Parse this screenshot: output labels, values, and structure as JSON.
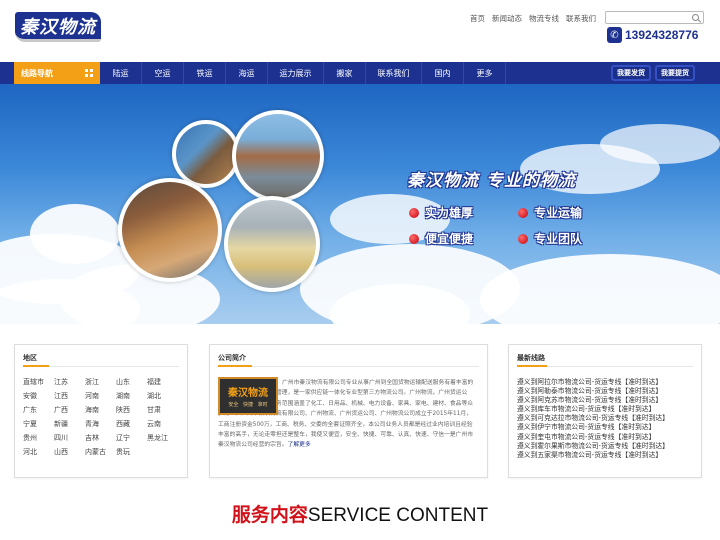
{
  "header": {
    "logo_text": "秦汉物流",
    "top_links": [
      "首页",
      "新闻动态",
      "物流专线",
      "联系我们"
    ],
    "search_placeholder": "",
    "phone": "13924328776"
  },
  "nav": {
    "guide_label": "线路导航",
    "items": [
      "陆运",
      "空运",
      "铁运",
      "海运",
      "运力展示",
      "搬家",
      "联系我们",
      "国内",
      "更多"
    ],
    "buttons": [
      "我要发货",
      "我要提货"
    ]
  },
  "banner": {
    "slogan": "秦汉物流 专业的物流",
    "features": [
      "实力雄厚",
      "专业运输",
      "便宜便捷",
      "专业团队"
    ]
  },
  "regions": {
    "title": "地区",
    "items": [
      "直辖市",
      "江苏",
      "浙江",
      "山东",
      "福建",
      "安徽",
      "江西",
      "河南",
      "湖南",
      "湖北",
      "广东",
      "广西",
      "海南",
      "陕西",
      "甘肃",
      "宁夏",
      "新疆",
      "青海",
      "西藏",
      "云南",
      "贵州",
      "四川",
      "吉林",
      "辽宁",
      "黑龙江",
      "河北",
      "山西",
      "内蒙古",
      "贵玩"
    ]
  },
  "about": {
    "title": "公司简介",
    "logo_name": "秦汉物流",
    "logo_sub": "安全 快捷 准时",
    "text": "广州市秦汉物流有限公司专业从事广州到全国货物运输配送服务有着丰富的运输组织，完善的经营管理，是一家供应链一体化专业型第三方物流公司。广州物流，广州货运公司，广州物流公司，业务范围涵盖了化工、日用品、机械、电力设备、家具、家电、建材、食品等众多行业。广州市秦汉物流有限公司、广州物流、广州货运公司、广州物流公司成立于2015年11月，工商注册资金500万，工商、税务、交委的全套证照齐全，本公司业务人员都是经过业内培训且经验丰富的高手，无论走零担还是整车，我使又便宜，安全、快捷、可靠、认真、快速、守信一是广州市秦汉物流公司经营的宗旨。",
    "more": "了解更多"
  },
  "routes": {
    "title": "最新线路",
    "items": [
      "遵义到阿拉尔市物流公司-货运专线【准时到达】",
      "遵义到阿勒泰市物流公司-货运专线【准时到达】",
      "遵义到阿克苏市物流公司-货运专线【准时到达】",
      "遵义到库车市物流公司-货运专线【准时到达】",
      "遵义到可克达拉市物流公司-货运专线【准时到达】",
      "遵义到伊宁市物流公司-货运专线【准时到达】",
      "遵义到奎屯市物流公司-货运专线【准时到达】",
      "遵义到霍尔果斯市物流公司-货运专线【准时到达】",
      "遵义到五家渠市物流公司-货运专线【准时到达】"
    ]
  },
  "service": {
    "title_cn": "服务内容",
    "title_en": "SERVICE CONTENT"
  },
  "colors": {
    "brand_blue": "#1d3290",
    "accent_orange": "#f3a016",
    "accent_red": "#d2121a"
  }
}
